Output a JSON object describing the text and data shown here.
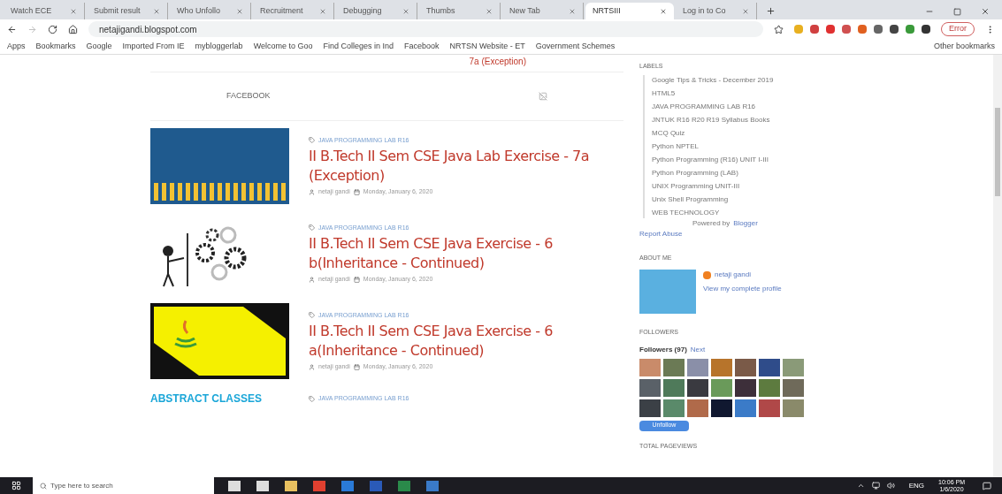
{
  "browser": {
    "tabs": [
      {
        "title": "Watch ECE",
        "selected": false
      },
      {
        "title": "Submit result",
        "selected": false
      },
      {
        "title": "Who Unfollo",
        "selected": false
      },
      {
        "title": "Recruitment",
        "selected": false
      },
      {
        "title": "Debugging",
        "selected": false
      },
      {
        "title": "Thumbs",
        "selected": false
      },
      {
        "title": "New Tab",
        "selected": false
      },
      {
        "title": "NRTSIII",
        "selected": true
      },
      {
        "title": "Log in to Co",
        "selected": false
      }
    ],
    "url": "netajigandi.blogspot.com",
    "profile_button": "Error",
    "bookmarks": [
      "Apps",
      "Bookmarks",
      "Google",
      "Imported From IE",
      "mybloggerlab",
      "Welcome to Goo",
      "Find Colleges in Ind",
      "Facebook",
      "NRTSN Website - ET",
      "Government Schemes"
    ],
    "other_bookmarks": "Other bookmarks"
  },
  "main": {
    "top_link": "7a (Exception)",
    "facebook_label": "FACEBOOK",
    "posts": [
      {
        "kind": "exception",
        "category": "JAVA PROGRAMMING LAB R16",
        "title": "II B.Tech II Sem CSE Java Lab Exercise - 7a (Exception)",
        "author": "netaji gandi",
        "date": "Monday, January 6, 2020"
      },
      {
        "kind": "gears",
        "category": "JAVA PROGRAMMING LAB R16",
        "title": "II B.Tech II Sem CSE Java Exercise - 6 b(Inheritance - Continued)",
        "author": "netaji gandi",
        "date": "Monday, January 6, 2020"
      },
      {
        "kind": "java",
        "category": "JAVA PROGRAMMING LAB R16",
        "title": "II B.Tech II Sem CSE Java Exercise - 6 a(Inheritance - Continued)",
        "author": "netaji gandi",
        "date": "Monday, January 6, 2020"
      },
      {
        "kind": "abstract",
        "category": "JAVA PROGRAMMING LAB R16"
      }
    ],
    "abstract_heading": "ABSTRACT CLASSES"
  },
  "sidebar": {
    "labels_heading": "LABELS",
    "labels": [
      "Google Tips & Tricks - December 2019",
      "HTML5",
      "JAVA PROGRAMMING LAB R16",
      "JNTUK R16 R20 R19 Syllabus Books",
      "MCQ Quiz",
      "Python NPTEL",
      "Python Programming (R16) UNIT I-III",
      "Python Programming (LAB)",
      "UNIX Programming UNIT-III",
      "Unix Shell Programming",
      "WEB TECHNOLOGY"
    ],
    "powered_prefix": "Powered by",
    "powered_link": "Blogger",
    "report": "Report Abuse",
    "about_heading": "ABOUT ME",
    "profile_name": "netaji gandi",
    "profile_link": "View my complete profile",
    "followers_heading": "FOLLOWERS",
    "followers_label": "Followers (97)",
    "followers_next": "Next",
    "follow_button": "Unfollow",
    "pageviews_heading": "TOTAL PAGEVIEWS"
  },
  "taskbar": {
    "search_placeholder": "Type here to search",
    "language": "ENG",
    "time": "10:06 PM",
    "date": "1/6/2020"
  }
}
